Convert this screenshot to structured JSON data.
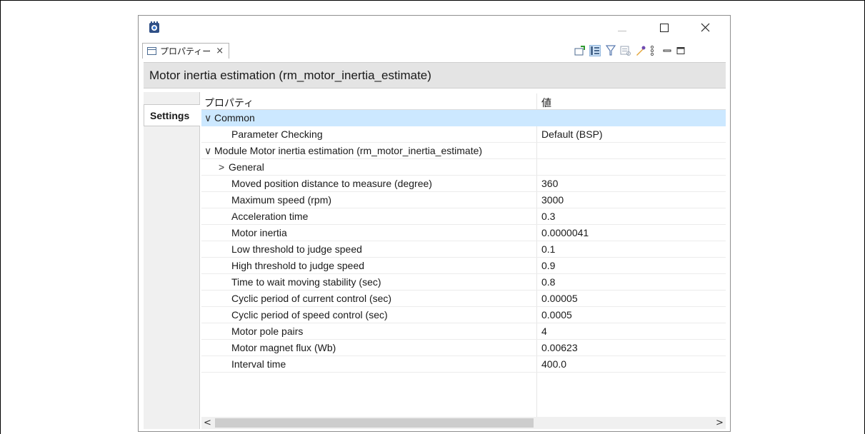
{
  "window": {
    "minimize_icon": "minimize-icon",
    "maximize_icon": "maximize-icon",
    "close_icon": "close-icon"
  },
  "tab": {
    "label": "プロパティー",
    "close_glyph": "×"
  },
  "toolbar": {
    "icons": [
      "pin-to-view-icon",
      "categories-icon",
      "filter-icon",
      "restore-default-icon",
      "advanced-icon",
      "view-menu-icon",
      "minimize-view-icon",
      "maximize-view-icon"
    ]
  },
  "header": {
    "title": "Motor inertia estimation (rm_motor_inertia_estimate)"
  },
  "side_tab": {
    "label": "Settings"
  },
  "table": {
    "col_property": "プロパティ",
    "col_value": "値",
    "rows": [
      {
        "name": "Common",
        "value": "",
        "expander": "∨",
        "selected": true
      },
      {
        "name": "Parameter Checking",
        "value": "Default (BSP)"
      },
      {
        "name": "Module  Motor inertia estimation (rm_motor_inertia_estimate)",
        "value": "",
        "expander": "∨"
      },
      {
        "name": "General",
        "value": "",
        "expander": ">"
      },
      {
        "name": "Moved position distance to measure (degree)",
        "value": "360"
      },
      {
        "name": "Maximum speed (rpm)",
        "value": "3000"
      },
      {
        "name": "Acceleration time",
        "value": "0.3"
      },
      {
        "name": "Motor inertia",
        "value": "0.0000041"
      },
      {
        "name": "Low threshold to judge speed",
        "value": "0.1"
      },
      {
        "name": "High threshold to judge speed",
        "value": "0.9"
      },
      {
        "name": "Time to wait moving stability (sec)",
        "value": "0.8"
      },
      {
        "name": "Cyclic period of current control (sec)",
        "value": "0.00005"
      },
      {
        "name": "Cyclic period of speed control (sec)",
        "value": "0.0005"
      },
      {
        "name": "Motor pole pairs",
        "value": "4"
      },
      {
        "name": "Motor magnet flux (Wb)",
        "value": "0.00623"
      },
      {
        "name": "Interval time",
        "value": "400.0"
      }
    ]
  },
  "scrollbar": {
    "left_arrow": "<",
    "right_arrow": ">"
  },
  "colors": {
    "selected_row": "#cce8ff",
    "header_band": "#e4e4e4",
    "side_panel": "#f0f0f0"
  }
}
